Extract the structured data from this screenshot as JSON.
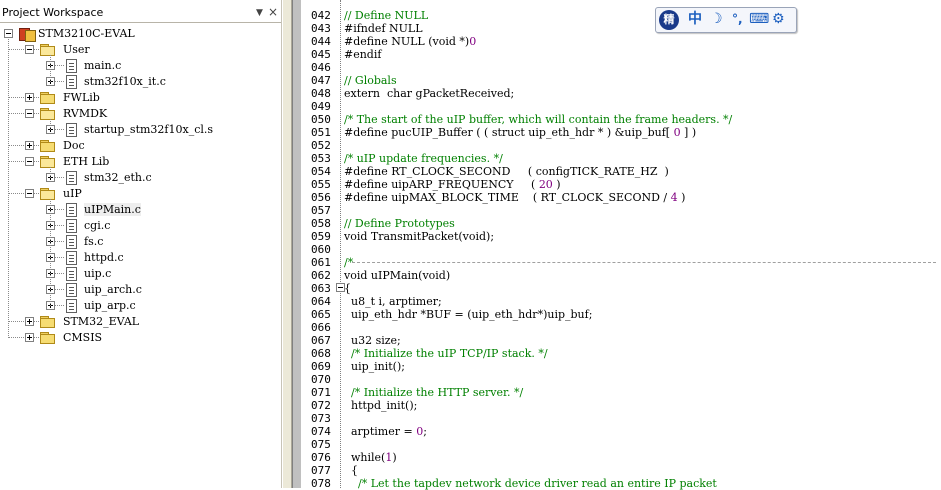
{
  "workspace": {
    "title": "Project Workspace",
    "dropdown_icon": "triangle-down-icon",
    "close_icon": "close-icon",
    "tree": {
      "project": "STM3210C-EVAL",
      "groups": [
        {
          "label": "User",
          "expanded": true,
          "files": [
            "main.c",
            "stm32f10x_it.c"
          ]
        },
        {
          "label": "FWLib",
          "expanded": false,
          "files": []
        },
        {
          "label": "RVMDK",
          "expanded": true,
          "files": [
            "startup_stm32f10x_cl.s"
          ]
        },
        {
          "label": "Doc",
          "expanded": false,
          "files": []
        },
        {
          "label": "ETH Lib",
          "expanded": true,
          "files": [
            "stm32_eth.c"
          ]
        },
        {
          "label": "uIP",
          "expanded": true,
          "files": [
            "uIPMain.c",
            "cgi.c",
            "fs.c",
            "httpd.c",
            "uip.c",
            "uip_arch.c",
            "uip_arp.c"
          ]
        },
        {
          "label": "STM32_EVAL",
          "expanded": false,
          "files": []
        },
        {
          "label": "CMSIS",
          "expanded": false,
          "files": []
        }
      ],
      "selected_file": "uIPMain.c"
    }
  },
  "ime_toolbar": {
    "logo": "精",
    "items": [
      "中",
      "☽",
      "°,",
      "⌨",
      "⚙"
    ]
  },
  "editor": {
    "lines": [
      {
        "n": "042",
        "segs": [
          {
            "t": "// Define NULL",
            "c": "cm"
          }
        ]
      },
      {
        "n": "043",
        "segs": [
          {
            "t": "#ifndef NULL"
          }
        ]
      },
      {
        "n": "044",
        "segs": [
          {
            "t": "#define NULL (void *)"
          },
          {
            "t": "0",
            "c": "nm"
          }
        ]
      },
      {
        "n": "045",
        "segs": [
          {
            "t": "#endif"
          }
        ]
      },
      {
        "n": "046",
        "segs": []
      },
      {
        "n": "047",
        "segs": [
          {
            "t": "// Globals",
            "c": "cm"
          }
        ]
      },
      {
        "n": "048",
        "segs": [
          {
            "t": "extern  char gPacketReceived;"
          }
        ]
      },
      {
        "n": "049",
        "segs": []
      },
      {
        "n": "050",
        "segs": [
          {
            "t": "/* The start of the uIP buffer, which will contain the frame headers. */",
            "c": "cm"
          }
        ]
      },
      {
        "n": "051",
        "segs": [
          {
            "t": "#define pucUIP_Buffer ( ( struct uip_eth_hdr * ) &uip_buf[ "
          },
          {
            "t": "0",
            "c": "nm"
          },
          {
            "t": " ] )"
          }
        ]
      },
      {
        "n": "052",
        "segs": []
      },
      {
        "n": "053",
        "segs": [
          {
            "t": "/* uIP update frequencies. */",
            "c": "cm"
          }
        ]
      },
      {
        "n": "054",
        "segs": [
          {
            "t": "#define RT_CLOCK_SECOND     ( configTICK_RATE_HZ  )"
          }
        ]
      },
      {
        "n": "055",
        "segs": [
          {
            "t": "#define uipARP_FREQUENCY     ( "
          },
          {
            "t": "20",
            "c": "nm"
          },
          {
            "t": " )"
          }
        ]
      },
      {
        "n": "056",
        "segs": [
          {
            "t": "#define uipMAX_BLOCK_TIME    ( RT_CLOCK_SECOND / "
          },
          {
            "t": "4",
            "c": "nm"
          },
          {
            "t": " )"
          }
        ]
      },
      {
        "n": "057",
        "segs": []
      },
      {
        "n": "058",
        "segs": [
          {
            "t": "// Define Prototypes",
            "c": "cm"
          }
        ]
      },
      {
        "n": "059",
        "segs": [
          {
            "t": "void TransmitPacket(void);"
          }
        ]
      },
      {
        "n": "060",
        "segs": []
      },
      {
        "n": "061",
        "segs": [
          {
            "t": "/*",
            "c": "cm"
          }
        ]
      },
      {
        "n": "062",
        "segs": [
          {
            "t": "void uIPMain(void)"
          }
        ]
      },
      {
        "n": "063",
        "segs": [
          {
            "t": "{"
          }
        ]
      },
      {
        "n": "064",
        "segs": [
          {
            "t": "  u8_t i, arptimer;"
          }
        ]
      },
      {
        "n": "065",
        "segs": [
          {
            "t": "  uip_eth_hdr *BUF = (uip_eth_hdr*)uip_buf;"
          }
        ]
      },
      {
        "n": "066",
        "segs": []
      },
      {
        "n": "067",
        "segs": [
          {
            "t": "  u32 size;"
          }
        ]
      },
      {
        "n": "068",
        "segs": [
          {
            "t": "  "
          },
          {
            "t": "/* Initialize the uIP TCP/IP stack. */",
            "c": "cm"
          }
        ]
      },
      {
        "n": "069",
        "segs": [
          {
            "t": "  uip_init();"
          }
        ]
      },
      {
        "n": "070",
        "segs": []
      },
      {
        "n": "071",
        "segs": [
          {
            "t": "  "
          },
          {
            "t": "/* Initialize the HTTP server. */",
            "c": "cm"
          }
        ]
      },
      {
        "n": "072",
        "segs": [
          {
            "t": "  httpd_init();"
          }
        ]
      },
      {
        "n": "073",
        "segs": []
      },
      {
        "n": "074",
        "segs": [
          {
            "t": "  arptimer = "
          },
          {
            "t": "0",
            "c": "nm"
          },
          {
            "t": ";"
          }
        ]
      },
      {
        "n": "075",
        "segs": []
      },
      {
        "n": "076",
        "segs": [
          {
            "t": "  while("
          },
          {
            "t": "1",
            "c": "nm"
          },
          {
            "t": ")"
          }
        ]
      },
      {
        "n": "077",
        "segs": [
          {
            "t": "  {"
          }
        ]
      },
      {
        "n": "078",
        "segs": [
          {
            "t": "    "
          },
          {
            "t": "/* Let the tapdev network device driver read an entire IP packet",
            "c": "cm"
          }
        ]
      }
    ]
  }
}
